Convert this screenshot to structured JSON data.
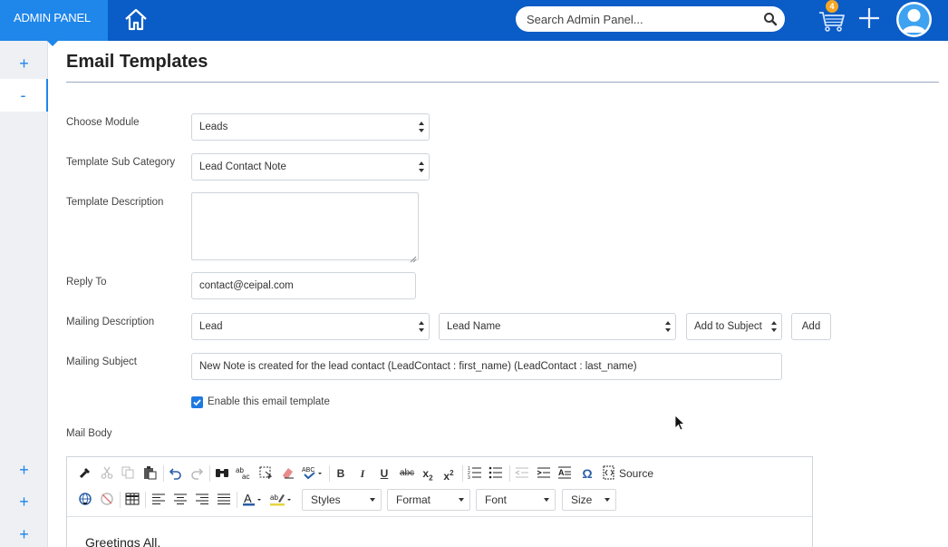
{
  "topbar": {
    "brand": "ADMIN PANEL",
    "search_placeholder": "Search Admin Panel...",
    "cart_count": "4"
  },
  "rail": {
    "top_plus": "+",
    "top_minus": "-",
    "bottom": [
      "+",
      "+",
      "+"
    ]
  },
  "page": {
    "title": "Email Templates"
  },
  "form": {
    "choose_module": {
      "label": "Choose Module",
      "value": "Leads"
    },
    "sub_category": {
      "label": "Template Sub Category",
      "value": "Lead Contact Note"
    },
    "description": {
      "label": "Template Description",
      "value": ""
    },
    "reply_to": {
      "label": "Reply To",
      "value": "contact@ceipal.com"
    },
    "mailing_description": {
      "label": "Mailing Description",
      "entity": "Lead",
      "field": "Lead Name",
      "target": "Add to Subject",
      "add_label": "Add"
    },
    "mailing_subject": {
      "label": "Mailing Subject",
      "value": "New Note is created for the lead contact (LeadContact : first_name) (LeadContact : last_name)"
    },
    "enable": {
      "label": "Enable this email template",
      "checked": true
    },
    "mail_body_label": "Mail Body"
  },
  "editor": {
    "source_label": "Source",
    "combos": {
      "styles": "Styles",
      "format": "Format",
      "font": "Font",
      "size": "Size"
    },
    "body_text": "Greetings All,"
  },
  "colors": {
    "topbar": "#0a5cc7",
    "brand": "#1f86ea",
    "accent": "#1f86ea"
  }
}
